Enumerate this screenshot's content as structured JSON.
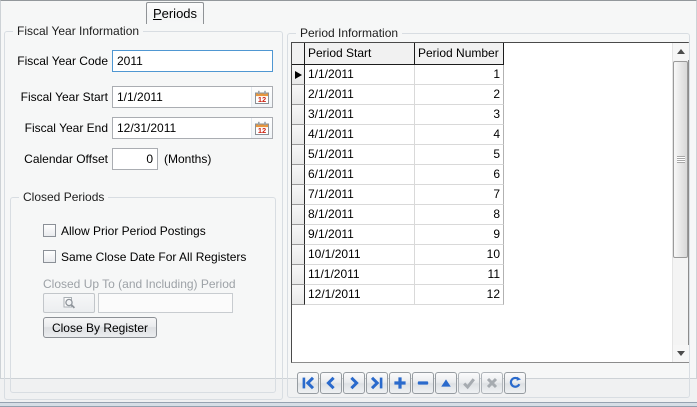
{
  "tab": {
    "label": "Periods",
    "underlined_letter": "P",
    "label_rest": "eriods"
  },
  "fiscal_year_info": {
    "title": "Fiscal Year Information",
    "code": {
      "label": "Fiscal Year Code",
      "value": "2011"
    },
    "start": {
      "label": "Fiscal Year Start",
      "value": "1/1/2011"
    },
    "end": {
      "label": "Fiscal Year End",
      "value": "12/31/2011"
    },
    "offset": {
      "label": "Calendar Offset",
      "value": "0",
      "suffix": "(Months)"
    }
  },
  "closed_periods": {
    "title": "Closed Periods",
    "checkbox_allow": {
      "label": "Allow Prior Period Postings",
      "checked": false
    },
    "checkbox_same": {
      "label": "Same Close Date For All Registers",
      "checked": false
    },
    "closed_up_to": {
      "label": "Closed Up To (and Including) Period",
      "value": ""
    },
    "close_by_register_button": "Close By Register"
  },
  "period_info": {
    "title": "Period Information",
    "columns": [
      "Period Start",
      "Period Number"
    ],
    "current_row": 1,
    "rows": [
      {
        "start": "1/1/2011",
        "number": "1"
      },
      {
        "start": "2/1/2011",
        "number": "2"
      },
      {
        "start": "3/1/2011",
        "number": "3"
      },
      {
        "start": "4/1/2011",
        "number": "4"
      },
      {
        "start": "5/1/2011",
        "number": "5"
      },
      {
        "start": "6/1/2011",
        "number": "6"
      },
      {
        "start": "7/1/2011",
        "number": "7"
      },
      {
        "start": "8/1/2011",
        "number": "8"
      },
      {
        "start": "9/1/2011",
        "number": "9"
      },
      {
        "start": "10/1/2011",
        "number": "10"
      },
      {
        "start": "11/1/2011",
        "number": "11"
      },
      {
        "start": "12/1/2011",
        "number": "12"
      }
    ]
  },
  "navigator": {
    "buttons": [
      "first",
      "prior",
      "next",
      "last",
      "insert",
      "delete",
      "edit",
      "post",
      "cancel",
      "refresh"
    ],
    "disabled_buttons": [
      "post",
      "cancel"
    ]
  },
  "colors": {
    "focused_input_border": "#4f97d2",
    "navigator_glyph_blue": "#2a6acc",
    "navigator_glyph_disabled": "#a6abb0",
    "calendar_icon_accent": "#e8963c",
    "calendar_icon_number": "#cc2211"
  }
}
